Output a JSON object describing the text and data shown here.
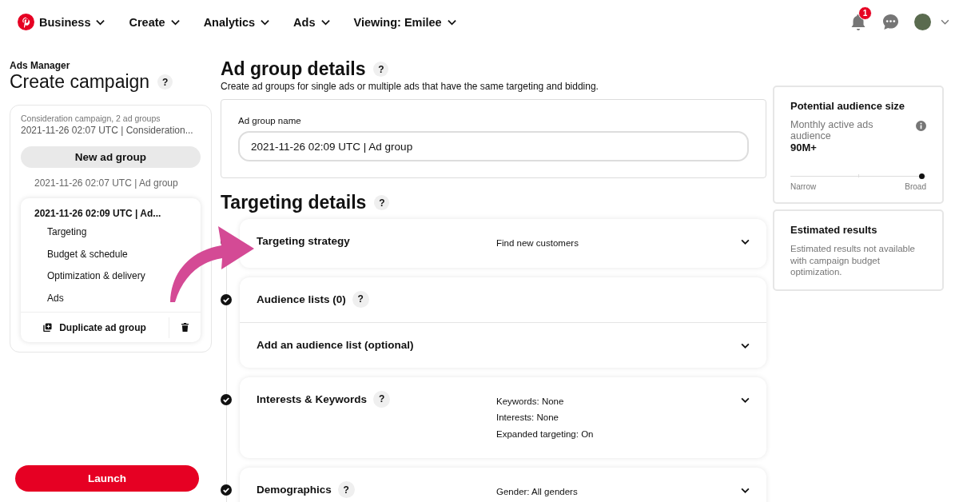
{
  "nav": {
    "items": [
      {
        "label": "Business"
      },
      {
        "label": "Create"
      },
      {
        "label": "Analytics"
      },
      {
        "label": "Ads"
      },
      {
        "label": "Viewing: Emilee"
      }
    ],
    "notification_count": "1"
  },
  "sidebar": {
    "eyebrow": "Ads Manager",
    "title": "Create campaign",
    "help": "?",
    "campaign": {
      "type": "Consideration campaign, 2 ad groups",
      "name": "2021-11-26 02:07 UTC | Consideration..."
    },
    "new_button": "New ad group",
    "ad_groups": [
      {
        "name": "2021-11-26 02:07 UTC | Ad group",
        "selected": false
      },
      {
        "name": "2021-11-26 02:09 UTC | Ad...",
        "selected": true,
        "steps": [
          "Targeting",
          "Budget & schedule",
          "Optimization & delivery",
          "Ads"
        ],
        "duplicate": "Duplicate ad group"
      }
    ],
    "launch": "Launch"
  },
  "main": {
    "title": "Ad group details",
    "title_help": "?",
    "subtitle": "Create ad groups for single ads or multiple ads that have the same targeting and bidding.",
    "name_field": {
      "label": "Ad group name",
      "value": "2021-11-26 02:09 UTC | Ad group"
    },
    "targeting_title": "Targeting details",
    "targeting_help": "?",
    "sections": [
      {
        "rows": [
          {
            "title": "Targeting strategy",
            "summary": [
              "Find new customers"
            ],
            "expandable": true
          }
        ]
      },
      {
        "rows": [
          {
            "title": "Audience lists (0)",
            "help": "?",
            "expandable": false
          },
          {
            "title": "Add an audience list (optional)",
            "expandable": true
          }
        ]
      },
      {
        "rows": [
          {
            "title": "Interests & Keywords",
            "help": "?",
            "summary": [
              "Keywords: None",
              "Interests: None",
              "Expanded targeting: On"
            ],
            "expandable": true
          }
        ]
      },
      {
        "rows": [
          {
            "title": "Demographics",
            "help": "?",
            "summary": [
              "Gender: All genders"
            ],
            "expandable": true
          }
        ]
      }
    ]
  },
  "audience": {
    "title": "Potential audience size",
    "label": "Monthly active ads audience",
    "value": "90M+",
    "level": 0.97,
    "min_label": "Narrow",
    "max_label": "Broad"
  },
  "estimate": {
    "title": "Estimated results",
    "text": "Estimated results not available with campaign budget optimization."
  }
}
